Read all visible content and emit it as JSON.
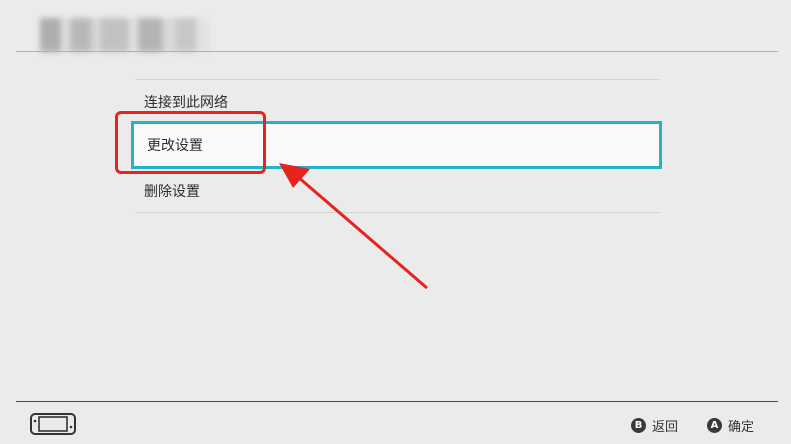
{
  "header": {
    "title": ""
  },
  "menu": {
    "items": [
      {
        "label": "连接到此网络"
      },
      {
        "label": "更改设置"
      },
      {
        "label": "删除设置"
      }
    ],
    "selected_index": 1
  },
  "footer": {
    "back": {
      "button_glyph": "B",
      "label": "返回"
    },
    "confirm": {
      "button_glyph": "A",
      "label": "确定"
    }
  },
  "icons": {
    "console": "handheld-console-icon"
  },
  "colors": {
    "selection_border": "#25b4c7",
    "annotation": "#e8221c",
    "background": "#ebebeb"
  }
}
